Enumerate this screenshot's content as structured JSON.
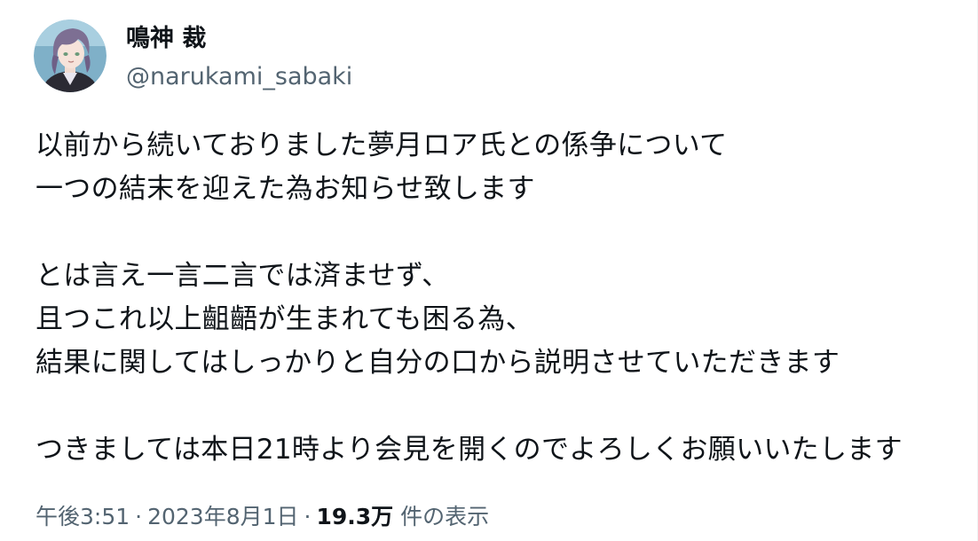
{
  "tweet": {
    "author": {
      "display_name": "鳴神 裁",
      "handle": "@narukami_sabaki",
      "avatar_icon": "user-avatar"
    },
    "paragraphs": [
      [
        "以前から続いておりました夢月ロア氏との係争について",
        "一つの結末を迎えた為お知らせ致します"
      ],
      [
        "とは言え一言二言では済ませず、",
        "且つこれ以上齟齬が生まれても困る為、",
        "結果に関してはしっかりと自分の口から説明させていただきます"
      ],
      [
        "つきましては本日21時より会見を開くのでよろしくお願いいたします"
      ]
    ],
    "meta": {
      "time": "午後3:51",
      "separator": "·",
      "date": "2023年8月1日",
      "views_count": "19.3万",
      "views_label": "件の表示"
    }
  },
  "colors": {
    "text": "#0f1419",
    "secondary": "#536471",
    "background": "#ffffff"
  }
}
